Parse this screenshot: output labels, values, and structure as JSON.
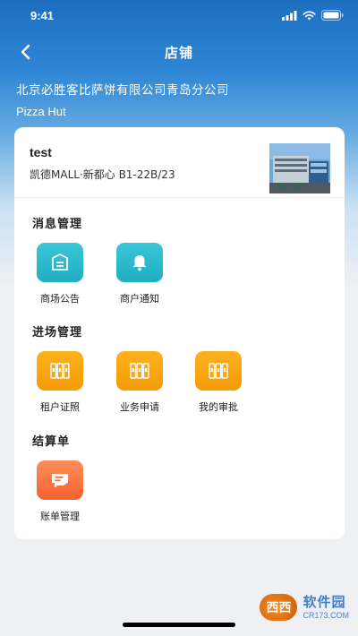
{
  "status_bar": {
    "time": "9:41"
  },
  "nav": {
    "title": "店铺"
  },
  "store": {
    "name": "北京必胜客比萨饼有限公司青岛分公司",
    "brand": "Pizza Hut"
  },
  "shop": {
    "title": "test",
    "location": "凯德MALL·新都心 B1-22B/23"
  },
  "sections": [
    {
      "title": "消息管理",
      "items": [
        {
          "label": "商场公告",
          "icon": "announcement-icon",
          "color": "#2bb7ca"
        },
        {
          "label": "商户通知",
          "icon": "bell-icon",
          "color": "#2bb7ca"
        }
      ]
    },
    {
      "title": "进场管理",
      "items": [
        {
          "label": "租户证照",
          "icon": "binders-icon",
          "color": "#f9a412"
        },
        {
          "label": "业务申请",
          "icon": "binders-icon",
          "color": "#f9a412"
        },
        {
          "label": "我的审批",
          "icon": "binders-icon",
          "color": "#f9a412"
        }
      ]
    },
    {
      "title": "结算单",
      "items": [
        {
          "label": "账单管理",
          "icon": "receipt-icon",
          "color": "#f6713b"
        }
      ]
    }
  ],
  "watermark": {
    "logo": "西西",
    "main": "软件园",
    "sub": "CR173.COM"
  }
}
